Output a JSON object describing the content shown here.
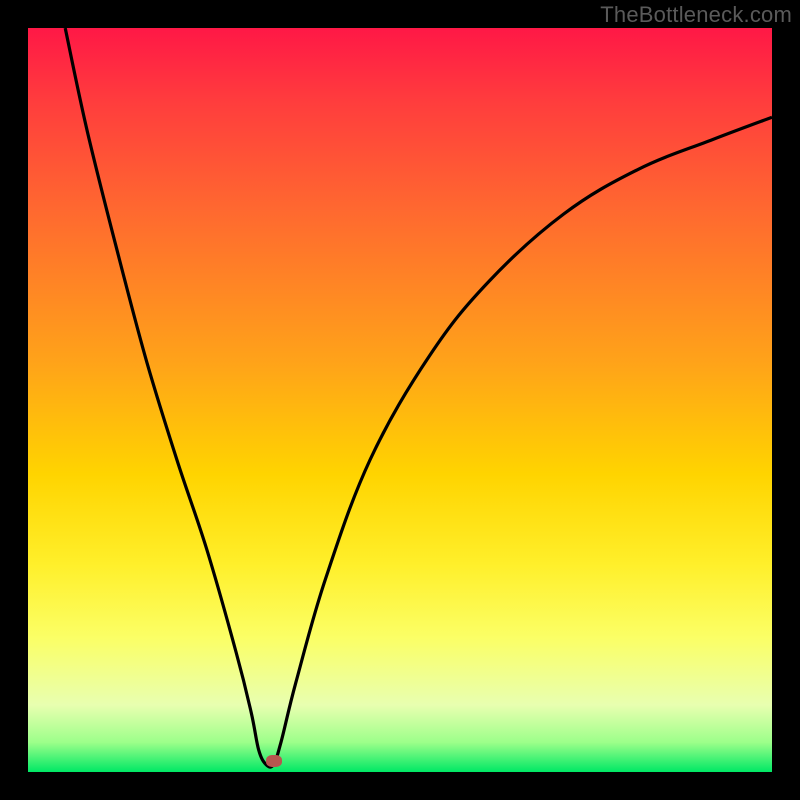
{
  "attribution": "TheBottleneck.com",
  "colors": {
    "background": "#000000",
    "gradient_top": "#ff1846",
    "gradient_bottom": "#00e865",
    "curve": "#000000",
    "marker": "#b7564f",
    "attribution_text": "#5a5a5a"
  },
  "chart_data": {
    "type": "line",
    "title": "",
    "xlabel": "",
    "ylabel": "",
    "xlim": [
      0,
      100
    ],
    "ylim": [
      0,
      100
    ],
    "notch_x": 32,
    "marker": {
      "x": 33,
      "y": 1.5
    },
    "series": [
      {
        "name": "bottleneck-curve",
        "x": [
          5,
          8,
          12,
          16,
          20,
          24,
          28,
          30,
          31,
          32,
          33,
          34,
          36,
          40,
          46,
          54,
          62,
          72,
          82,
          92,
          100
        ],
        "y": [
          100,
          86,
          70,
          55,
          42,
          30,
          16,
          8,
          3,
          1,
          1,
          4,
          12,
          26,
          42,
          56,
          66,
          75,
          81,
          85,
          88
        ]
      }
    ]
  }
}
